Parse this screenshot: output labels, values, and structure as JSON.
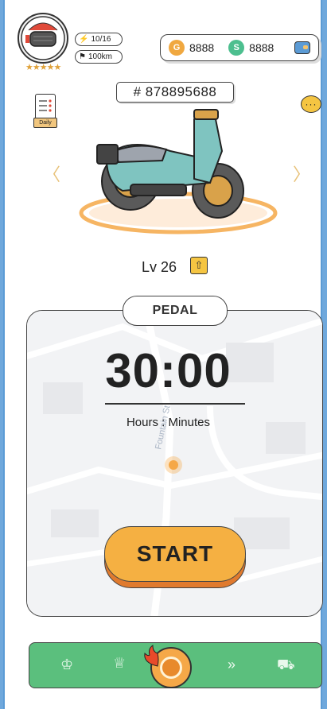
{
  "profile": {
    "energy": "10/16",
    "distance": "100km",
    "stars": "★★★★★"
  },
  "currency": {
    "gold_symbol": "G",
    "gold": "8888",
    "silver_symbol": "S",
    "silver": "8888"
  },
  "vehicle": {
    "id": "# 878895688",
    "level": "Lv 26"
  },
  "daily": {
    "label": "Daily"
  },
  "mode": {
    "label": "PEDAL"
  },
  "timer": {
    "value": "30:00",
    "units": "Hours : Minutes"
  },
  "map": {
    "street_label": "Fountain St"
  },
  "actions": {
    "start_label": "START"
  },
  "icons": {
    "energy": "lightning-icon",
    "distance": "flag-icon",
    "wallet": "wallet-icon",
    "more": "more-icon",
    "prev": "chevron-left-icon",
    "next": "chevron-right-icon",
    "upgrade": "upgrade-arrow-icon",
    "nav": [
      "crown-icon",
      "trophy-icon",
      "wheel-icon",
      "arrow-icon",
      "cart-icon"
    ]
  },
  "colors": {
    "accent": "#f5b042",
    "nav_bg": "#5bbf7d",
    "frame": "#5b9bd5"
  }
}
